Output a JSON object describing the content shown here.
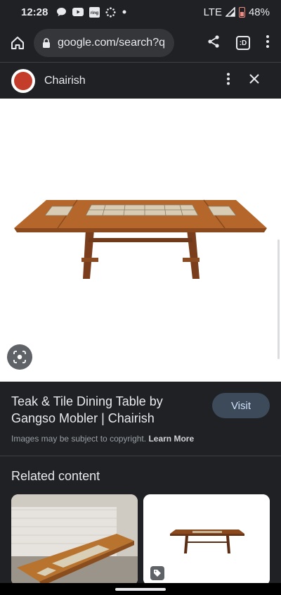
{
  "status_bar": {
    "time": "12:28",
    "network": "LTE",
    "battery": "48%",
    "notification_icons": [
      "chat-bubble-icon",
      "youtube-icon",
      "ring-icon",
      "sync-icon",
      "dot-icon"
    ],
    "ring_label": "ring"
  },
  "browser": {
    "url": "google.com/search?q",
    "tab_count": ":D"
  },
  "panel": {
    "site_name": "Chairish"
  },
  "result": {
    "title": "Teak & Tile Dining Table by Gangso Mobler | Chairish",
    "visit_label": "Visit",
    "copyright_text": "Images may be subject to copyright.",
    "learn_more_label": "Learn More"
  },
  "related": {
    "title": "Related content"
  },
  "colors": {
    "background": "#202124",
    "accent_button": "#3c4a5a",
    "battery_low": "#f28b82"
  }
}
